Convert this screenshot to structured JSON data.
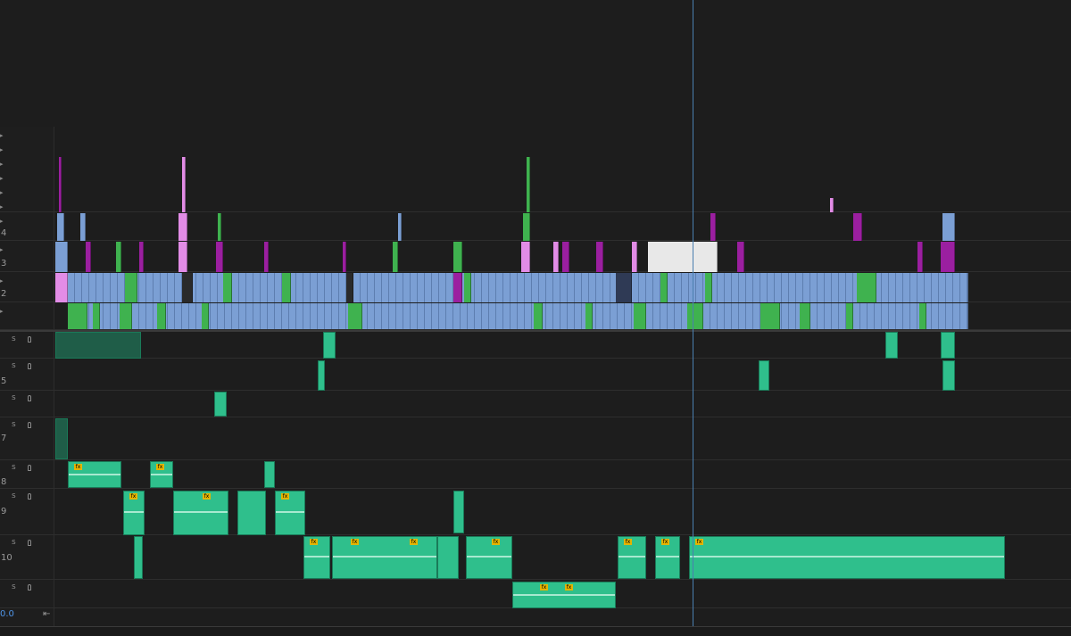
{
  "timeline": {
    "timecode": "0.0",
    "video_track_labels": [
      "4",
      "3",
      "2"
    ],
    "audio_track_labels": [
      "5",
      "7",
      "8",
      "9",
      "10"
    ],
    "solo_label": "s",
    "fx_label": "fx",
    "colors": {
      "video_blue": "#7b9fd4",
      "video_green": "#3fb24f",
      "video_magenta": "#9b1fa0",
      "video_pink": "#e28ce6",
      "video_white": "#e8e8e8",
      "audio_clip": "#2fbf8c",
      "playhead": "#4a7fb0",
      "timecode": "#4f95e8",
      "fx_badge": "#e4b400"
    }
  }
}
